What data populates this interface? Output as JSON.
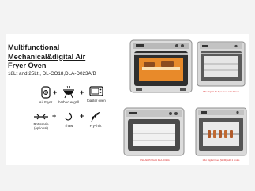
{
  "headline": {
    "line1": "Multifunctional",
    "line2": "Mechanical&digital Air",
    "line3": "Fryer Oven"
  },
  "subtitle": "18Lt and 25Lt , DL-CO18,DLA-D023A/B",
  "functions": [
    {
      "label": "Air Fryer",
      "icon": "fan-icon"
    },
    {
      "label": "barbecue grill",
      "icon": "grill-icon"
    },
    {
      "label": "toaster oven",
      "icon": "toaster-oven-icon"
    },
    {
      "label": "Rotisserie\n(optional)",
      "icon": "rotisserie-icon"
    },
    {
      "label": "Thaw",
      "icon": "thaw-icon"
    },
    {
      "label": "Fry-fruit",
      "icon": "fruit-icon"
    }
  ],
  "plus_sign": "+",
  "captions": {
    "top_right": "18Lt Digital Air fryer oven with 2 knob",
    "bottom_left": "DSL-AR25 Model DLA-D023A",
    "bottom_right": "18Lt Digital Oven (Wt/M) with 2 knobs"
  },
  "colors": {
    "steel": "#d9d9d9",
    "steel_dark": "#8f8f8f",
    "window": "#3a3a3a",
    "glow": "#f6a23a",
    "caption": "#dd3333"
  }
}
